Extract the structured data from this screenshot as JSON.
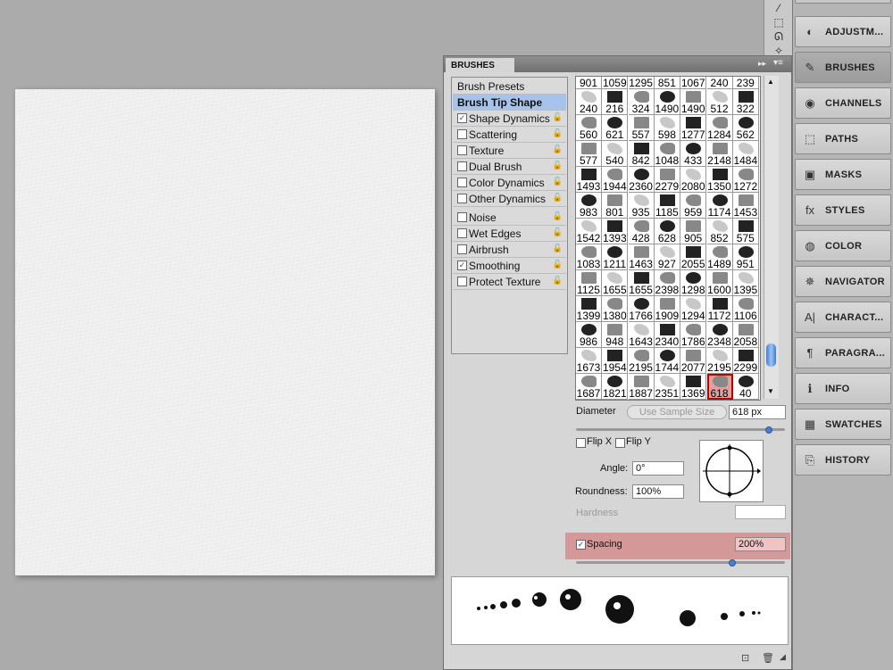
{
  "dock": {
    "items": [
      {
        "label": "ADJUSTM...",
        "icon": "adjustments-icon",
        "glyph": "◐"
      },
      {
        "label": "BRUSHES",
        "icon": "brush-icon",
        "glyph": "✎"
      },
      {
        "label": "CHANNELS",
        "icon": "channels-icon",
        "glyph": "◉"
      },
      {
        "label": "PATHS",
        "icon": "paths-icon",
        "glyph": "⬚"
      },
      {
        "label": "MASKS",
        "icon": "masks-icon",
        "glyph": "▣"
      },
      {
        "label": "STYLES",
        "icon": "styles-icon",
        "glyph": "fx"
      },
      {
        "label": "COLOR",
        "icon": "color-palette-icon",
        "glyph": "◍"
      },
      {
        "label": "NAVIGATOR",
        "icon": "navigator-icon",
        "glyph": "✵"
      },
      {
        "label": "CHARACT...",
        "icon": "character-icon",
        "glyph": "A|"
      },
      {
        "label": "PARAGRA...",
        "icon": "paragraph-icon",
        "glyph": "¶"
      },
      {
        "label": "INFO",
        "icon": "info-icon",
        "glyph": "ℹ"
      },
      {
        "label": "SWATCHES",
        "icon": "swatches-icon",
        "glyph": "▦"
      },
      {
        "label": "HISTORY",
        "icon": "history-icon",
        "glyph": "⎘"
      }
    ],
    "active_index": 1
  },
  "tools": {
    "items": [
      {
        "icon": "eyedropper-icon",
        "glyph": "⁄"
      },
      {
        "icon": "marquee-icon",
        "glyph": "⬚"
      },
      {
        "icon": "lasso-icon",
        "glyph": "ᘏ"
      },
      {
        "icon": "quick-select-icon",
        "glyph": "✧"
      }
    ]
  },
  "panel": {
    "tab_label": "BRUSHES",
    "collapse_glyph": "▸▸",
    "menu_glyph": "▾≡",
    "options": [
      {
        "label": "Brush Presets",
        "type": "header",
        "checked": false
      },
      {
        "label": "Brush Tip Shape",
        "type": "selected",
        "checked": false
      },
      {
        "label": "Shape Dynamics",
        "type": "option",
        "checked": true
      },
      {
        "label": "Scattering",
        "type": "option",
        "checked": false
      },
      {
        "label": "Texture",
        "type": "option",
        "checked": false
      },
      {
        "label": "Dual Brush",
        "type": "option",
        "checked": false
      },
      {
        "label": "Color Dynamics",
        "type": "option",
        "checked": false
      },
      {
        "label": "Other Dynamics",
        "type": "option",
        "checked": false
      },
      {
        "label": "Noise",
        "type": "option",
        "checked": false
      },
      {
        "label": "Wet Edges",
        "type": "option",
        "checked": false
      },
      {
        "label": "Airbrush",
        "type": "option",
        "checked": false
      },
      {
        "label": "Smoothing",
        "type": "option",
        "checked": true
      },
      {
        "label": "Protect Texture",
        "type": "option",
        "checked": false
      }
    ],
    "brush_sizes": [
      "901",
      "1059",
      "1295",
      "851",
      "1067",
      "240",
      "239",
      "240",
      "216",
      "324",
      "1490",
      "1490",
      "512",
      "322",
      "560",
      "621",
      "557",
      "598",
      "1277",
      "1284",
      "562",
      "577",
      "540",
      "842",
      "1048",
      "433",
      "2148",
      "1484",
      "1493",
      "1944",
      "2360",
      "2279",
      "2080",
      "1350",
      "1272",
      "983",
      "801",
      "935",
      "1185",
      "959",
      "1174",
      "1453",
      "1542",
      "1393",
      "428",
      "628",
      "905",
      "852",
      "575",
      "1083",
      "1211",
      "1463",
      "927",
      "2055",
      "1489",
      "951",
      "1125",
      "1655",
      "1655",
      "2398",
      "1298",
      "1600",
      "1395",
      "1399",
      "1380",
      "1766",
      "1909",
      "1294",
      "1172",
      "1106",
      "986",
      "948",
      "1643",
      "2340",
      "1786",
      "2348",
      "2058",
      "1673",
      "1954",
      "2195",
      "1744",
      "2077",
      "2195",
      "2299",
      "1687",
      "1821",
      "1887",
      "2351",
      "1369",
      "618",
      "40"
    ],
    "selected_brush_index": 89,
    "diameter_label": "Diameter",
    "use_sample_size_label": "Use Sample Size",
    "diameter_value": "618 px",
    "diameter_slider_fraction": 0.93,
    "flip_x_label": "Flip X",
    "flip_y_label": "Flip Y",
    "angle_label": "Angle:",
    "angle_value": "0°",
    "roundness_label": "Roundness:",
    "roundness_value": "100%",
    "hardness_label": "Hardness",
    "spacing_label": "Spacing",
    "spacing_checked": true,
    "spacing_value": "200%",
    "spacing_slider_fraction": 0.75,
    "highlight_color": "#d49898"
  }
}
